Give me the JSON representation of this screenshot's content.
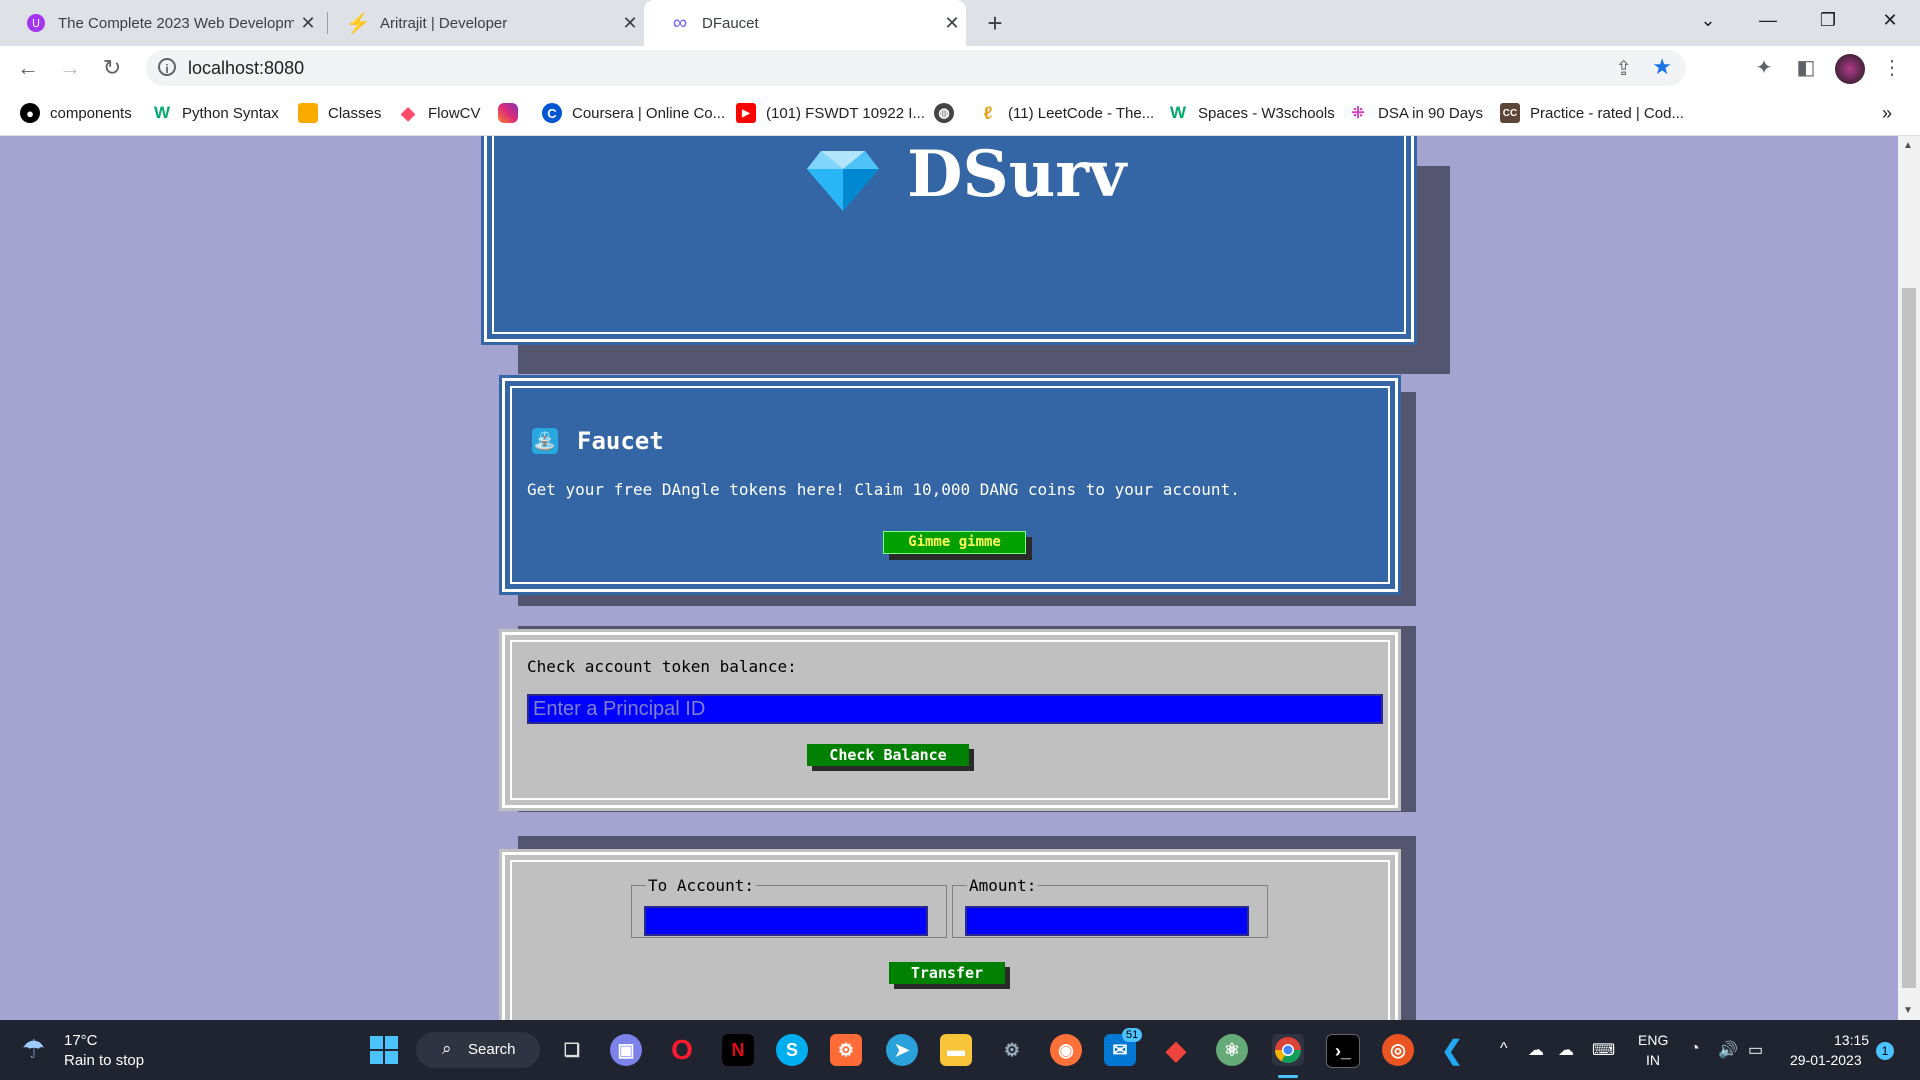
{
  "browser": {
    "tabs": [
      {
        "title": "The Complete 2023 Web Developme",
        "icon": "udemy-icon",
        "color": "#a435f0"
      },
      {
        "title": "Aritrajit | Developer",
        "icon": "bolt-icon",
        "color": "#f2b233"
      },
      {
        "title": "DFaucet",
        "icon": "infinity-icon",
        "color": "#6c63ff"
      }
    ],
    "active_tab": 2,
    "url": "localhost:8080",
    "bookmarks": [
      {
        "label": "components",
        "icon": "github-icon"
      },
      {
        "label": "Python Syntax",
        "icon": "w3schools-icon"
      },
      {
        "label": "Classes",
        "icon": "classroom-icon"
      },
      {
        "label": "FlowCV",
        "icon": "flowcv-icon"
      },
      {
        "label": "",
        "icon": "instagram-icon"
      },
      {
        "label": "Coursera | Online Co...",
        "icon": "coursera-icon"
      },
      {
        "label": "(101) FSWDT 10922 I...",
        "icon": "youtube-icon"
      },
      {
        "label": "",
        "icon": "globe-icon"
      },
      {
        "label": "(11) LeetCode - The...",
        "icon": "leetcode-icon"
      },
      {
        "label": "Spaces - W3schools",
        "icon": "w3schools-icon"
      },
      {
        "label": "DSA in 90 Days",
        "icon": "dsa-icon"
      },
      {
        "label": "Practice - rated | Cod...",
        "icon": "codechef-icon"
      }
    ],
    "more_bookmarks": "»"
  },
  "page": {
    "brand": "DSurv",
    "brand_icon": "diamond-icon",
    "faucet": {
      "title": "Faucet",
      "icon": "faucet-icon",
      "description": "Get your free DAngle tokens here! Claim 10,000 DANG coins to your account.",
      "button": "Gimme gimme"
    },
    "balance": {
      "label": "Check account token balance:",
      "placeholder": "Enter a Principal ID",
      "button": "Check Balance"
    },
    "transfer": {
      "to_label": "To Account:",
      "amount_label": "Amount:",
      "to_value": "",
      "amount_value": "",
      "button": "Transfer"
    }
  },
  "taskbar": {
    "weather_temp": "17°C",
    "weather_desc": "Rain to stop",
    "search_label": "Search",
    "mail_badge": "51",
    "lang_line1": "ENG",
    "lang_line2": "IN",
    "time": "13:15",
    "date": "29-01-2023",
    "notification_count": "1"
  },
  "colors": {
    "page_bg": "#a5a3cf",
    "panel_blue": "#3465a4",
    "panel_gray": "#c0c0c0",
    "input_blue": "#0000ff",
    "button_green": "#008000"
  }
}
